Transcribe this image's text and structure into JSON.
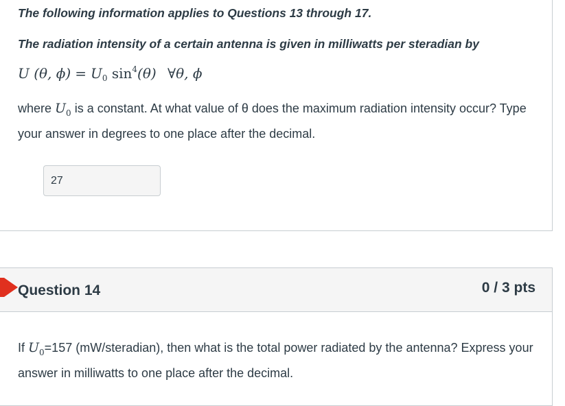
{
  "q13": {
    "intro": "The following information applies to Questions 13 through 17.",
    "prompt": "The radiation intensity of a certain antenna is given in milliwatts per steradian by",
    "equation": {
      "lhs": "U (θ, ϕ)",
      "eq": "=",
      "rhs_coef": "U",
      "rhs_coef_sub": "0",
      "rhs_func": "sin",
      "rhs_pow": "4",
      "rhs_arg": "(θ)",
      "rhs_forall": "∀θ, ϕ"
    },
    "body_pre": "where ",
    "body_u": "U",
    "body_u_sub": "0",
    "body_post": " is a constant.  At what value of θ does the maximum radiation intensity occur? Type your answer in degrees to one place after the decimal.",
    "answer_value": "27"
  },
  "q14": {
    "title": "Question 14",
    "points": "0 / 3 pts",
    "body_pre": "If ",
    "body_u": "U",
    "body_u_sub": "0",
    "body_post": "=157 (mW/steradian), then what is the total power radiated by the antenna? Express your answer in milliwatts to one place after the decimal.",
    "flag_color": "#e0301e"
  }
}
